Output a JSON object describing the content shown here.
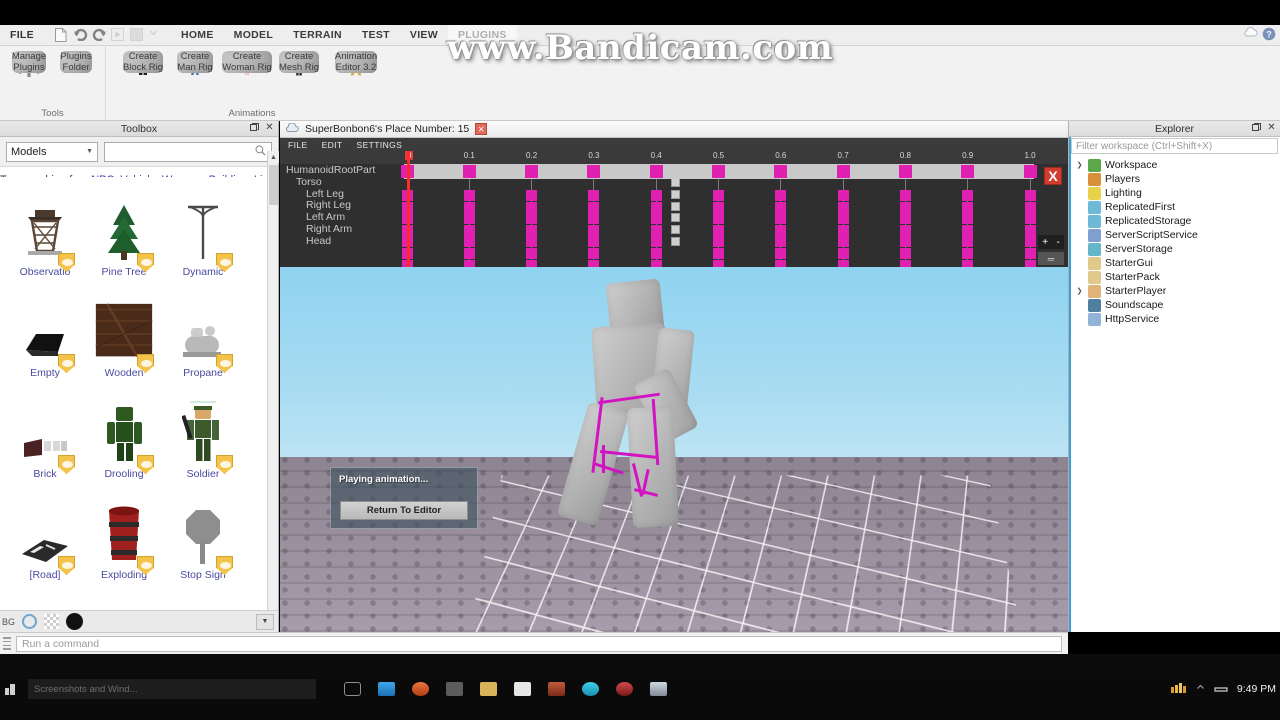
{
  "watermark": "www.Bandicam.com",
  "ribbon": {
    "tabs": [
      {
        "label": "FILE",
        "active": false
      },
      {
        "label": "HOME",
        "active": false
      },
      {
        "label": "MODEL",
        "active": false
      },
      {
        "label": "TERRAIN",
        "active": false
      },
      {
        "label": "TEST",
        "active": false
      },
      {
        "label": "VIEW",
        "active": false
      },
      {
        "label": "PLUGINS",
        "active": true
      }
    ],
    "quick_access": [
      "new-file-icon",
      "undo-icon",
      "redo-icon",
      "play-icon",
      "stop-icon",
      "chevron-down-icon"
    ],
    "groups": [
      {
        "name": "Tools",
        "items": [
          {
            "label": "Manage\nPlugins",
            "icon": "gear-icon"
          },
          {
            "label": "Plugins\nFolder",
            "icon": "folder-plug-icon"
          }
        ]
      },
      {
        "name": "Animations",
        "items": [
          {
            "label": "Create\nBlock Rig",
            "icon": "block-rig-icon"
          },
          {
            "label": "Create\nMan Rig",
            "icon": "man-rig-icon"
          },
          {
            "label": "Create\nWoman Rig",
            "icon": "woman-rig-icon"
          },
          {
            "label": "Create\nMesh Rig",
            "icon": "mesh-rig-icon"
          },
          {
            "label": "Animation\nEditor 3.2",
            "icon": "animation-editor-icon"
          }
        ]
      }
    ],
    "right_icons": [
      "cloud-icon",
      "help-icon"
    ]
  },
  "toolbox": {
    "title": "Toolbox",
    "category": "Models",
    "search_placeholder": "",
    "search_value": "",
    "hint_label": "Try searching for:",
    "hint_links": [
      "NPC",
      "Vehicle",
      "Weapon",
      "Building",
      "Light"
    ],
    "items": [
      {
        "name": "Observatio",
        "thumb": "observatory"
      },
      {
        "name": "Pine Tree",
        "thumb": "pine-tree"
      },
      {
        "name": "Dynamic",
        "thumb": "lamp-post"
      },
      {
        "name": "Empty",
        "thumb": "empty-black"
      },
      {
        "name": "Wooden",
        "thumb": "wooden-crate"
      },
      {
        "name": "Propane",
        "thumb": "propane-tank"
      },
      {
        "name": "Brick",
        "thumb": "brick-dark"
      },
      {
        "name": "Drooling",
        "thumb": "zombie-green"
      },
      {
        "name": "Soldier",
        "thumb": "soldier"
      },
      {
        "name": "[Road]",
        "thumb": "road"
      },
      {
        "name": "Exploding",
        "thumb": "red-barrel"
      },
      {
        "name": "Stop Sign",
        "thumb": "stop-sign"
      }
    ],
    "bottom_swatches": [
      "ring-swatch",
      "transparent-swatch",
      "black-swatch"
    ],
    "bottom_label": "BG"
  },
  "animation_editor": {
    "title": "SuperBonbon6's Place Number: 15",
    "menu": [
      "FILE",
      "EDIT",
      "SETTINGS"
    ],
    "tracks": [
      "HumanoidRootPart",
      "Torso",
      "Left Leg",
      "Right Leg",
      "Left Arm",
      "Right Arm",
      "Head"
    ],
    "time_labels": [
      "0",
      "0.1",
      "0.2",
      "0.3",
      "0.4",
      "0.5",
      "0.6",
      "0.7",
      "0.8",
      "0.9",
      "1.0"
    ],
    "playhead_time": "0",
    "zoom_in_label": "+",
    "zoom_out_label": "-",
    "close_label": "X"
  },
  "viewport": {
    "dialog_message": "Playing animation...",
    "dialog_button": "Return To Editor"
  },
  "explorer": {
    "title": "Explorer",
    "filter_placeholder": "Filter workspace (Ctrl+Shift+X)",
    "items": [
      {
        "label": "Workspace",
        "expandable": true,
        "color": "#5aa84a"
      },
      {
        "label": "Players",
        "expandable": false,
        "color": "#d98f3a"
      },
      {
        "label": "Lighting",
        "expandable": false,
        "color": "#e8d24a"
      },
      {
        "label": "ReplicatedFirst",
        "expandable": false,
        "color": "#6fb9d8"
      },
      {
        "label": "ReplicatedStorage",
        "expandable": false,
        "color": "#6fb9d8"
      },
      {
        "label": "ServerScriptService",
        "expandable": false,
        "color": "#7f9fd0"
      },
      {
        "label": "ServerStorage",
        "expandable": false,
        "color": "#63b7c9"
      },
      {
        "label": "StarterGui",
        "expandable": false,
        "color": "#e0c98a"
      },
      {
        "label": "StarterPack",
        "expandable": false,
        "color": "#e0c98a"
      },
      {
        "label": "StarterPlayer",
        "expandable": true,
        "color": "#e0b37a"
      },
      {
        "label": "Soundscape",
        "expandable": false,
        "color": "#4f7f9e"
      },
      {
        "label": "HttpService",
        "expandable": false,
        "color": "#93b4d8"
      }
    ]
  },
  "command_bar": {
    "placeholder": "Run a command"
  },
  "taskbar": {
    "window_title": "Screenshots and Wind...",
    "clock": "9:49 PM",
    "apps": [
      "task-view-icon",
      "explorer-icon",
      "firefox-icon",
      "app-icon",
      "folder-icon",
      "app2-icon",
      "app3-icon",
      "app4-icon",
      "app5-icon",
      "app6-icon"
    ]
  },
  "colors": {
    "keyframe": "#e020b0",
    "playhead": "#ff2b2b",
    "accent": "#3aa0d8",
    "link": "#3b3ba8"
  }
}
